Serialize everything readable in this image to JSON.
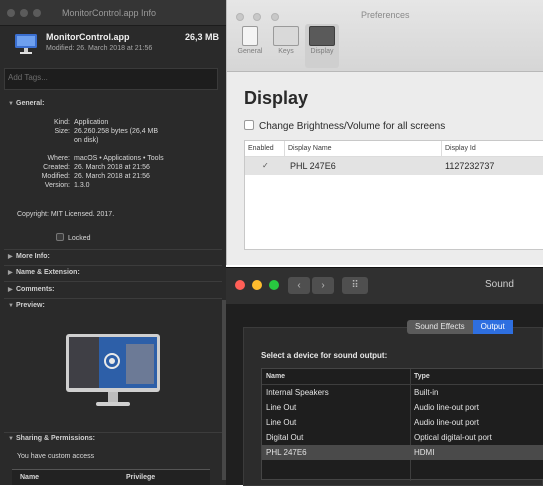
{
  "info_window": {
    "title": "MonitorControl.app Info",
    "app_name": "MonitorControl.app",
    "app_size": "26,3 MB",
    "modified_line": "Modified: 26. March 2018 at 21:56",
    "tags_placeholder": "Add Tags...",
    "general_header": "General:",
    "fields": [
      {
        "key": "Kind:",
        "value": "Application"
      },
      {
        "key": "Size:",
        "value": "26.260.258 bytes (26,4 MB"
      },
      {
        "key": "",
        "value": "on disk)"
      },
      {
        "key": "Where:",
        "value": "macOS • Applications • Tools"
      },
      {
        "key": "Created:",
        "value": "26. March 2018 at 21:56"
      },
      {
        "key": "Modified:",
        "value": "26. March 2018 at 21:56"
      },
      {
        "key": "Version:",
        "value": "1.3.0"
      }
    ],
    "copyright": "Copyright: MIT Licensed. 2017.",
    "locked_label": "Locked",
    "sections": [
      "More Info:",
      "Name & Extension:",
      "Comments:",
      "Preview:"
    ],
    "sharing_header": "Sharing & Permissions:",
    "sharing_text": "You have custom access",
    "perm_headers": [
      "Name",
      "Privilege"
    ]
  },
  "prefs_window": {
    "title": "Preferences",
    "toolbar": [
      "General",
      "Keys",
      "Display"
    ],
    "heading": "Display",
    "checkbox_label": "Change Brightness/Volume for all screens",
    "table_headers": [
      "Enabled",
      "Display Name",
      "Display Id"
    ],
    "rows": [
      {
        "enabled": "✓",
        "name": "PHL 247E6",
        "id": "1127232737"
      }
    ]
  },
  "sound_window": {
    "title": "Sound",
    "tabs": [
      "Sound Effects",
      "Output"
    ],
    "prompt": "Select a device for sound output:",
    "headers": [
      "Name",
      "Type"
    ],
    "devices": [
      {
        "name": "Internal Speakers",
        "type": "Built-in"
      },
      {
        "name": "Line Out",
        "type": "Audio line-out port"
      },
      {
        "name": "Line Out",
        "type": "Audio line-out port"
      },
      {
        "name": "Digital Out",
        "type": "Optical digital-out port"
      },
      {
        "name": "PHL 247E6",
        "type": "HDMI"
      }
    ]
  },
  "colors": {
    "accent": "#2e6fe0",
    "close": "#ff5f57",
    "minimize": "#febc2e",
    "zoom": "#28c840"
  }
}
